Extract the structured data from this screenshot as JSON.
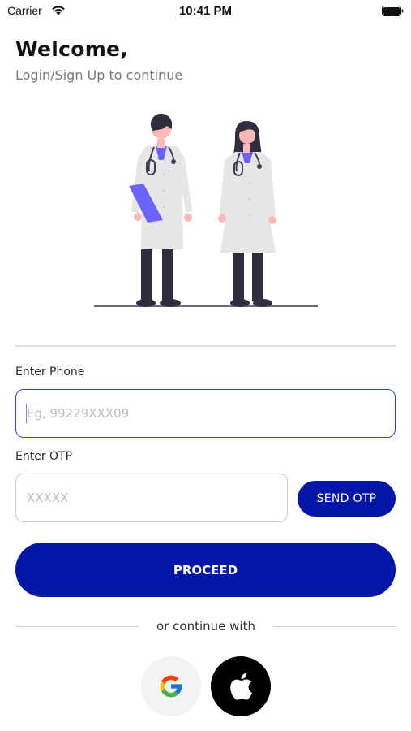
{
  "status_bar": {
    "carrier": "Carrier",
    "time": "10:41 PM"
  },
  "header": {
    "title": "Welcome,",
    "subtitle": "Login/Sign Up to continue"
  },
  "illustration": {
    "subject": "two-doctors"
  },
  "form": {
    "phone_label": "Enter Phone",
    "phone_placeholder": "Eg, 99229XXX09",
    "phone_value": "",
    "otp_label": "Enter OTP",
    "otp_placeholder": "XXXXX",
    "otp_value": "",
    "send_otp_label": "SEND OTP",
    "proceed_label": "PROCEED"
  },
  "alt_login": {
    "label": "or continue with",
    "providers": [
      {
        "name": "google",
        "icon": "google-icon"
      },
      {
        "name": "apple",
        "icon": "apple-icon"
      }
    ]
  },
  "colors": {
    "primary": "#0416a8",
    "input_focus_border": "#3a46b8",
    "accent_clipboard": "#6c63ff"
  }
}
